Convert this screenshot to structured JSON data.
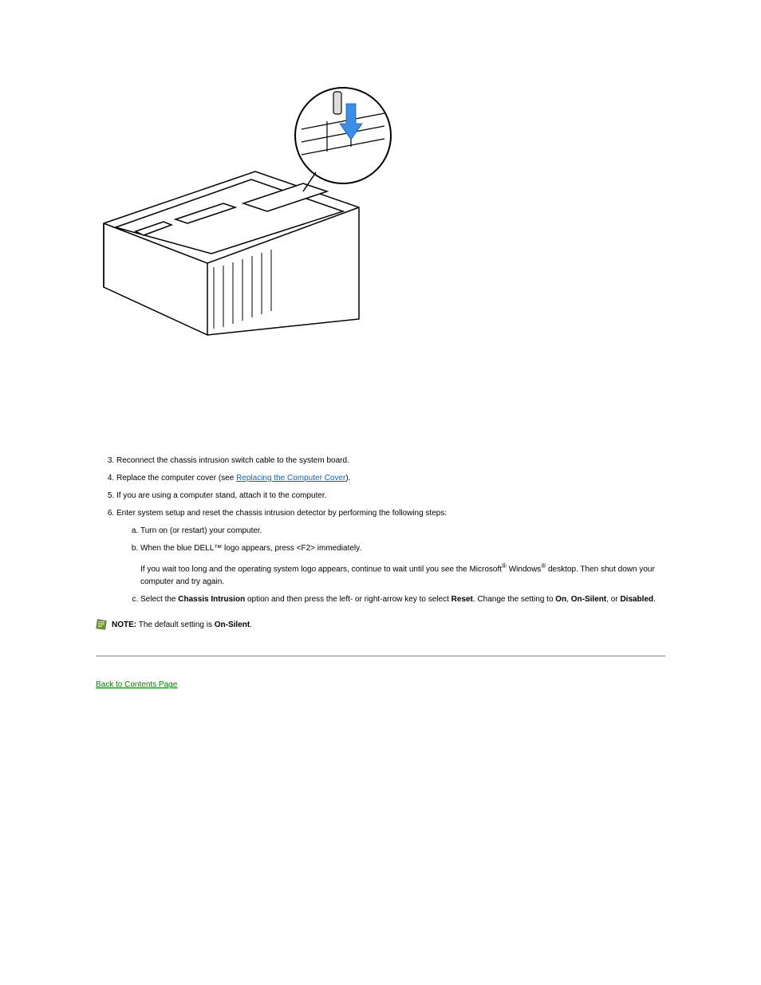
{
  "figure": {
    "alt": "Illustration of a desktop computer chassis lying on its side with the cover removed, showing the system board and a circular callout highlighting the chassis intrusion switch being pushed down into its slot."
  },
  "steps": {
    "step3": "Reconnect the chassis intrusion switch cable to the system board.",
    "step4": "Replace the computer cover (see ",
    "step4_link": "Replacing the Computer Cover",
    "step4_tail": ").",
    "step5": "If you are using a computer stand, attach it to the computer.",
    "step6": {
      "intro": "Enter system setup and reset the chassis intrusion detector by performing the following steps:",
      "a": "Turn on (or restart) your computer.",
      "b": "When the blue DELL™ logo appears, press <F2> immediately.",
      "b_follow1": "If you wait too long and the operating system logo appears, continue to wait until you see the Microsoft",
      "b_follow2": " Windows",
      "b_follow3": " desktop. Then shut down your computer and try again.",
      "c_1": "Select the ",
      "c_bold": "Chassis Intrusion",
      "c_2": " option and then press the left- or right-arrow key to select ",
      "c_bold2": "Reset",
      "c_3": ". Change the setting to ",
      "c_bold3": "On",
      "c_4": ", ",
      "c_bold4": "On-Silent",
      "c_5": ", or ",
      "c_bold5": "Disabled",
      "c_6": "."
    }
  },
  "note": {
    "label": "NOTE:",
    "text_1": " The default setting is ",
    "bold": "On-Silent",
    "text_2": "."
  },
  "back": "Back to Contents Page"
}
